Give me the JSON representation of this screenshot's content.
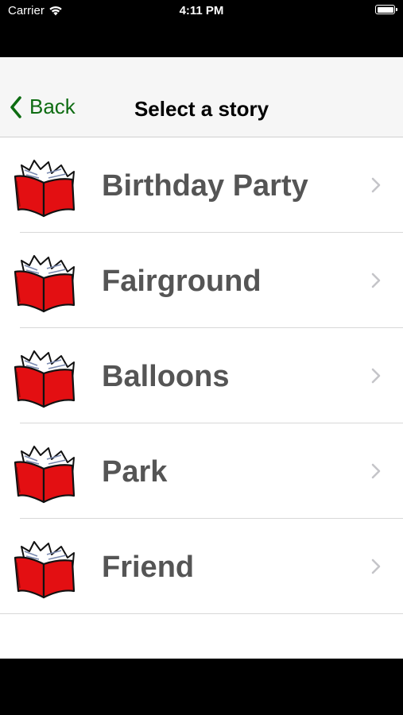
{
  "status_bar": {
    "carrier": "Carrier",
    "time": "4:11 PM"
  },
  "nav": {
    "back_label": "Back",
    "title": "Select a story",
    "accent_color": "#0e6c12"
  },
  "stories": [
    {
      "label": "Birthday Party",
      "icon": "book-icon"
    },
    {
      "label": "Fairground",
      "icon": "book-icon"
    },
    {
      "label": "Balloons",
      "icon": "book-icon"
    },
    {
      "label": "Park",
      "icon": "book-icon"
    },
    {
      "label": "Friend",
      "icon": "book-icon"
    }
  ]
}
